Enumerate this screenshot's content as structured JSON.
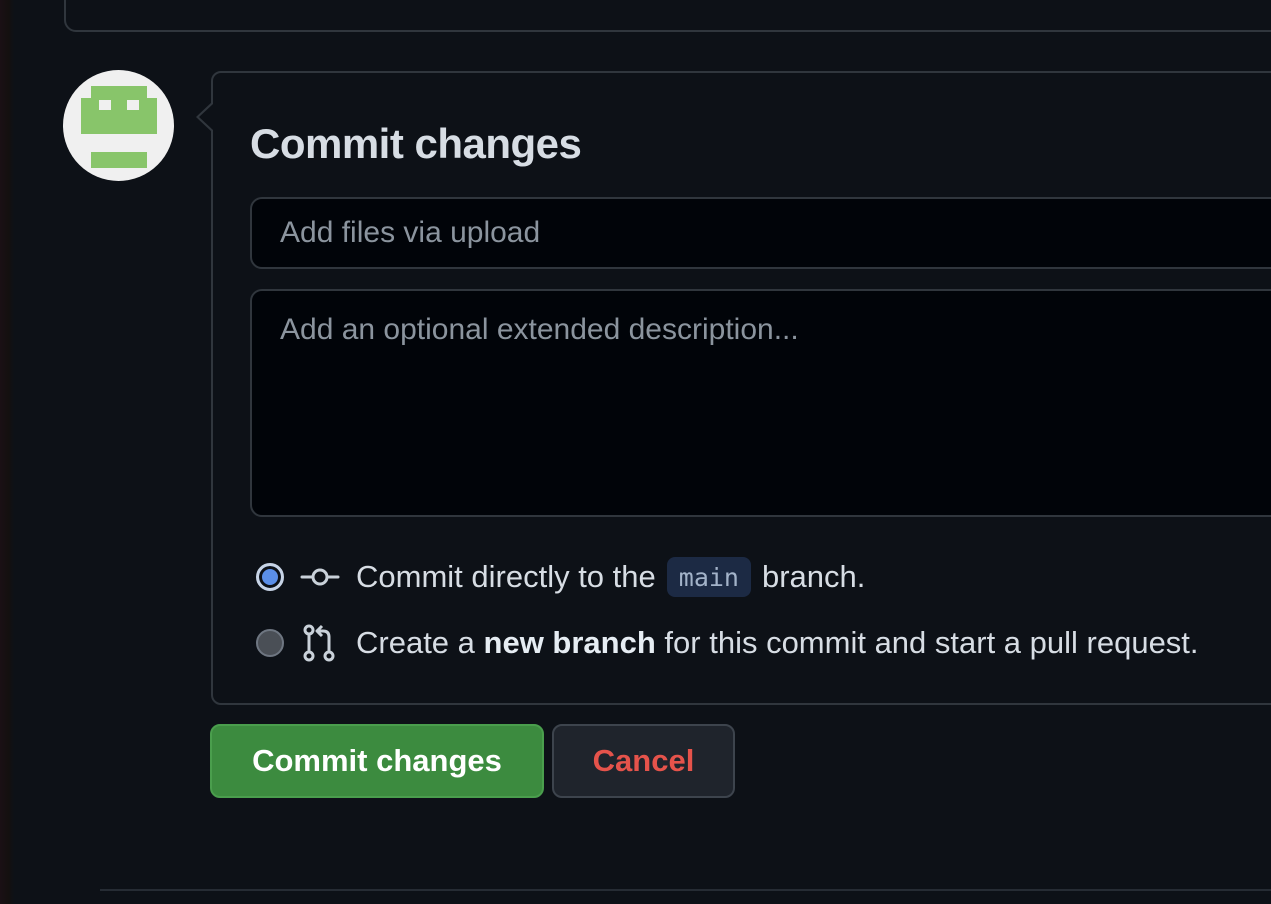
{
  "commit_form": {
    "title": "Commit changes",
    "summary_placeholder": "Add files via upload",
    "summary_value": "",
    "description_placeholder": "Add an optional extended description...",
    "description_value": "",
    "options": {
      "direct": {
        "prefix": "Commit directly to the",
        "branch": "main",
        "suffix": "branch.",
        "selected": true
      },
      "new_branch": {
        "prefix": "Create a",
        "bold": "new branch",
        "suffix": "for this commit and start a pull request.",
        "selected": false
      }
    },
    "icons": {
      "avatar": "identicon-avatar",
      "direct_commit": "git-commit-icon",
      "pull_request": "git-pull-request-icon"
    }
  },
  "buttons": {
    "commit_label": "Commit changes",
    "cancel_label": "Cancel"
  },
  "colors": {
    "commit_button_bg": "#3c8b3f",
    "cancel_text": "#e5534b",
    "radio_selected": "#5b8fe8",
    "avatar_green": "#88c56a"
  }
}
